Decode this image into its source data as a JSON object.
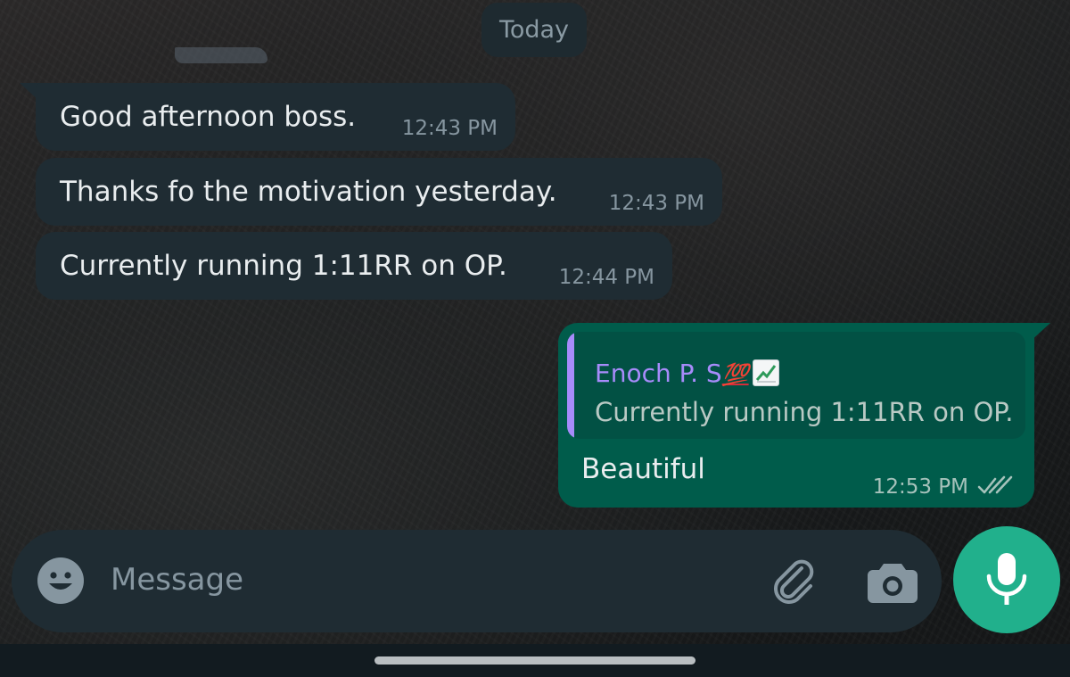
{
  "date_separator": "Today",
  "messages_incoming": [
    {
      "text": "Good afternoon boss.",
      "time": "12:43 PM"
    },
    {
      "text": "Thanks fo the motivation yesterday.",
      "time": "12:43 PM"
    },
    {
      "text": "Currently running 1:11RR on OP.",
      "time": "12:44 PM"
    }
  ],
  "message_outgoing": {
    "quoted_author": "Enoch P. S",
    "quoted_author_emojis": [
      "hundred-points-emoji",
      "chart-increasing-emoji"
    ],
    "hundred_emoji_text": "💯",
    "quoted_text": "Currently running 1:11RR on OP.",
    "text": "Beautiful",
    "time": "12:53 PM",
    "status": "read"
  },
  "composer": {
    "placeholder": "Message",
    "icons": [
      "emoji-icon",
      "attachment-icon",
      "camera-icon",
      "microphone-icon"
    ]
  },
  "colors": {
    "incoming_bubble": "#1f2c33",
    "outgoing_bubble": "#005c4b",
    "quote_accent": "#a78bfa",
    "mic_button": "#21b08c"
  }
}
